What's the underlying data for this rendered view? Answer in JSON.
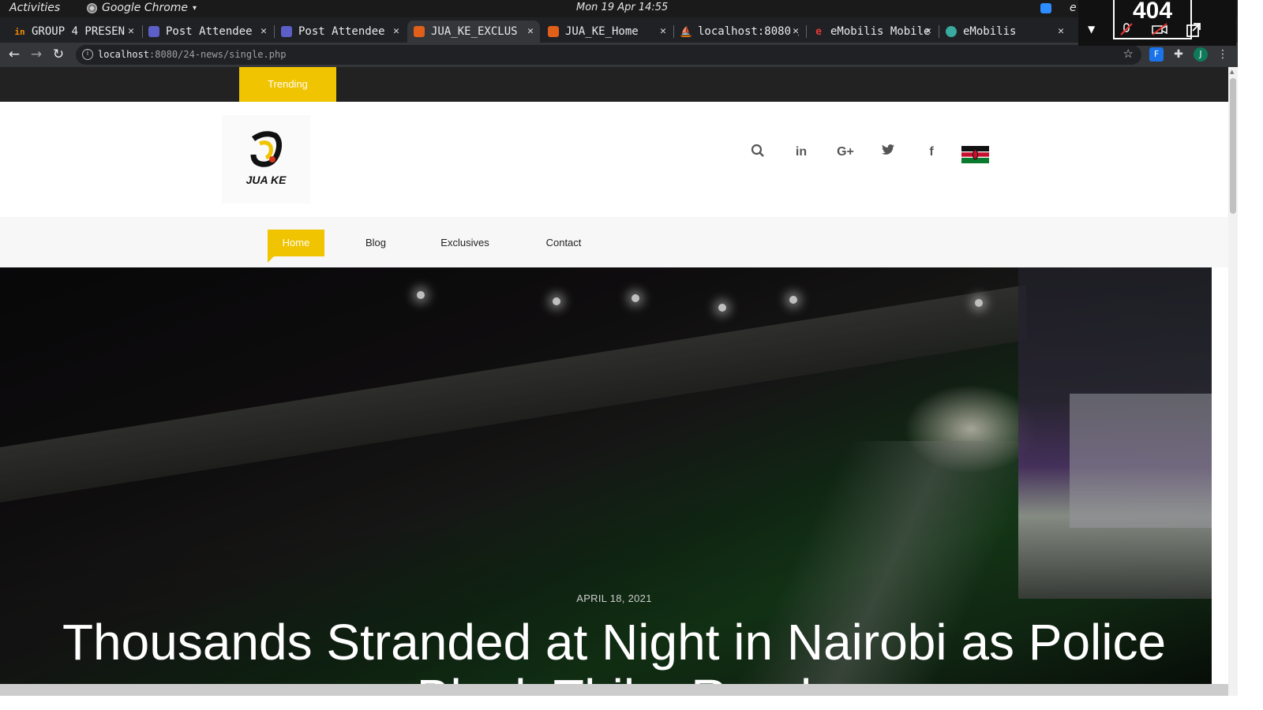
{
  "os": {
    "activities": "Activities",
    "app_name": "Google Chrome",
    "clock": "Mon 19 Apr 14:55",
    "tray_letter": "e"
  },
  "overlay": {
    "code": "404"
  },
  "tabs": [
    {
      "label": "GROUP 4 PRESEN",
      "fav_color": "#f28b00",
      "fav_glyph": "in"
    },
    {
      "label": "Post Attendee",
      "fav_color": "#5b5fc7",
      "fav_glyph": ""
    },
    {
      "label": "Post Attendee",
      "fav_color": "#5b5fc7",
      "fav_glyph": ""
    },
    {
      "label": "JUA_KE_EXCLUS",
      "fav_color": "#e0601a",
      "fav_glyph": ""
    },
    {
      "label": "JUA_KE_Home",
      "fav_color": "#e0601a",
      "fav_glyph": ""
    },
    {
      "label": "localhost:8080 / ",
      "fav_color": "#e37400",
      "fav_glyph": ""
    },
    {
      "label": "eMobilis Mobile",
      "fav_color": "#202124",
      "fav_glyph": "e"
    },
    {
      "label": "eMobilis",
      "fav_color": "#3aa9a0",
      "fav_glyph": ""
    }
  ],
  "address": {
    "host": "localhost",
    "path": ":8080/24-news/single.php"
  },
  "profile_initial": "J",
  "site": {
    "trending": "Trending",
    "logo_text": "JUA KE",
    "nav": [
      "Home",
      "Blog",
      "Exclusives",
      "Contact"
    ],
    "social": {
      "linkedin": "in",
      "gplus": "G+",
      "twitter": "t",
      "facebook": "f"
    }
  },
  "article": {
    "date": "APRIL 18, 2021",
    "title": "Thousands Stranded at Night in Nairobi as Police Block Thika Road"
  },
  "colors": {
    "accent": "#f0c400",
    "topbar": "#222222"
  }
}
